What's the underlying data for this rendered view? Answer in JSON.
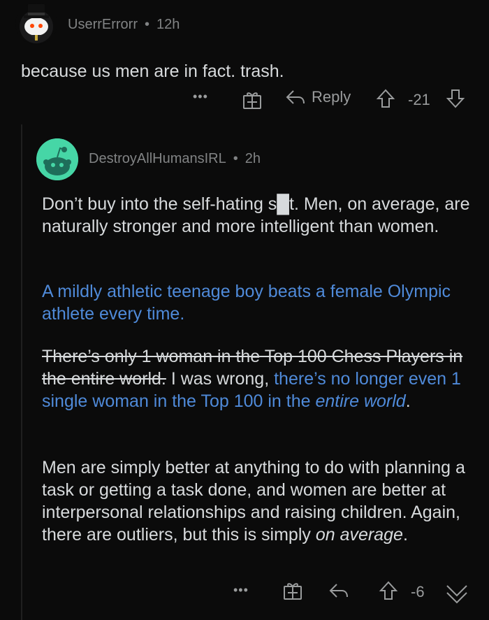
{
  "comment1": {
    "username": "UserrErrorr",
    "separator": "•",
    "time": "12h",
    "text": "because us men are in fact. trash.",
    "actions": {
      "more": "•••",
      "reply_label": "Reply",
      "score": "-21"
    }
  },
  "comment2": {
    "username": "DestroyAllHumansIRL",
    "separator": "•",
    "time": "2h",
    "p1": "Don’t buy into the self-hating s█t. Men, on average, are naturally stronger and more intelligent than women.",
    "p2": "A mildly athletic teenage boy beats a female Olympic athlete every time.",
    "p3_strike": "There’s only 1 woman in the Top 100 Chess Players in the entire world.",
    "p3_mid": " I was wrong, ",
    "p3_link_a": "there’s no longer even 1 single woman in the Top 100 in the ",
    "p3_link_italic": "entire world",
    "p3_end": ".",
    "p4_main": "Men are simply better at anything to do with planning a task or getting a task done, and women are better at interpersonal relationships and raising children. Again, there are outliers, but this is simply ",
    "p4_italic": "on average",
    "p4_end": ".",
    "actions": {
      "more": "•••",
      "score": "-6"
    }
  },
  "colors": {
    "background": "#0b0b0b",
    "text": "#d7dadc",
    "muted": "#818384",
    "link": "#4f8ad9",
    "avatar2_bg": "#46d6a6"
  },
  "icons": [
    "snoo-avatar-tophat",
    "snoo-avatar-teal",
    "more-icon",
    "award-icon",
    "reply-icon",
    "upvote-icon",
    "downvote-icon"
  ]
}
